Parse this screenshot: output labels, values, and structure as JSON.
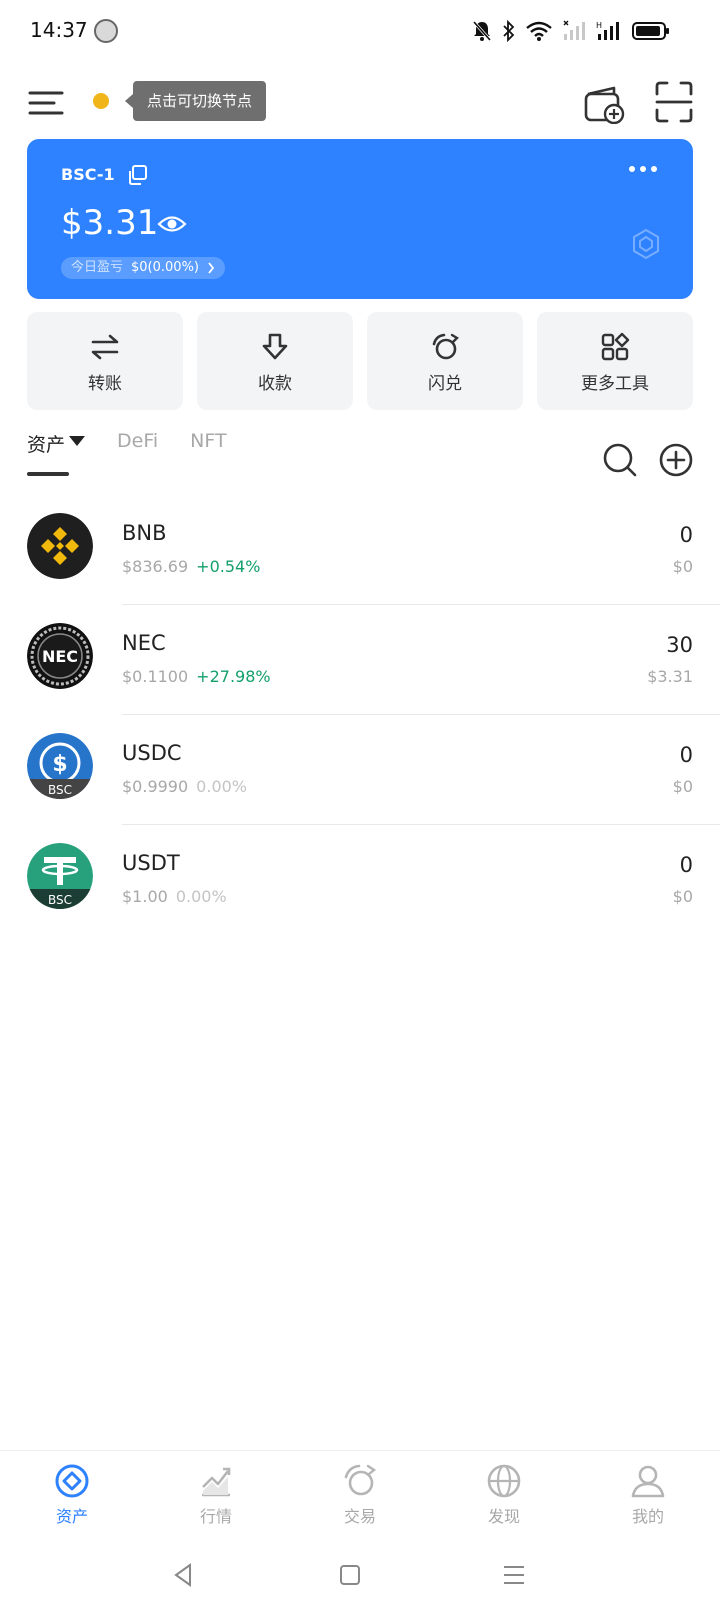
{
  "status_bar": {
    "time": "14:37"
  },
  "header": {
    "node_tooltip": "点击可切换节点",
    "node_dot_color": "#f0b518"
  },
  "card": {
    "account_name": "BSC-1",
    "balance": "$3.31",
    "pnl_label": "今日盈亏",
    "pnl_value": "$0(0.00%)",
    "background_color": "#2e82ff"
  },
  "actions": [
    {
      "label": "转账",
      "icon": "transfer-icon"
    },
    {
      "label": "收款",
      "icon": "receive-icon"
    },
    {
      "label": "闪兑",
      "icon": "swap-icon"
    },
    {
      "label": "更多工具",
      "icon": "grid-icon"
    }
  ],
  "tabs": [
    {
      "label": "资产",
      "active": true
    },
    {
      "label": "DeFi",
      "active": false
    },
    {
      "label": "NFT",
      "active": false
    }
  ],
  "assets": [
    {
      "symbol": "BNB",
      "price": "$836.69",
      "change": "+0.54%",
      "amount": "0",
      "value": "$0",
      "logo": "bnb-logo"
    },
    {
      "symbol": "NEC",
      "price": "$0.1100",
      "change": "+27.98%",
      "amount": "30",
      "value": "$3.31",
      "logo": "nec-logo"
    },
    {
      "symbol": "USDC",
      "price": "$0.9990",
      "change": "0.00%",
      "amount": "0",
      "value": "$0",
      "logo": "usdc-logo",
      "logo_badge": "BSC"
    },
    {
      "symbol": "USDT",
      "price": "$1.00",
      "change": "0.00%",
      "amount": "0",
      "value": "$0",
      "logo": "usdt-logo",
      "logo_badge": "BSC"
    }
  ],
  "bottom_nav": [
    {
      "label": "资产",
      "active": true,
      "icon": "assets-icon"
    },
    {
      "label": "行情",
      "active": false,
      "icon": "market-icon"
    },
    {
      "label": "交易",
      "active": false,
      "icon": "trade-icon"
    },
    {
      "label": "发现",
      "active": false,
      "icon": "discover-icon"
    },
    {
      "label": "我的",
      "active": false,
      "icon": "profile-icon"
    }
  ],
  "colors": {
    "accent": "#2e82ff",
    "positive": "#14a06b",
    "muted": "#a8a8a8"
  }
}
